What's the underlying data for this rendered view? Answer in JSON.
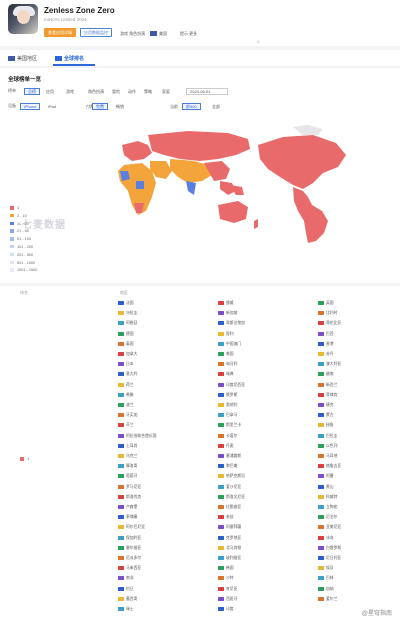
{
  "app": {
    "title": "Zenless Zone Zero",
    "subtitle": "miHoYo Limited 2024",
    "btn_primary": "查看应用详情",
    "btn_secondary": "应用数据监控",
    "meta": [
      "游戏 角色扮演",
      "美国",
      "提示 更多"
    ]
  },
  "tabs": [
    {
      "label": "美国地区",
      "flag": "#3c5aa8",
      "active": false
    },
    {
      "label": "全球排名",
      "flag": "#2b67d6",
      "active": true
    }
  ],
  "panel": {
    "title": "全球榜单一览",
    "row1_label": "榜单",
    "row1": [
      "总榜",
      "应用",
      "游戏",
      "角色扮演",
      "冒险",
      "动作",
      "策略",
      "家庭",
      "2024-06-01"
    ],
    "row2_label": "设备",
    "row2": [
      "iPhone",
      "iPad",
      "",
      "付费",
      "免费",
      "畅销",
      "",
      "",
      "当前",
      "前500",
      "全部"
    ],
    "legend": [
      "1",
      "2 - 10",
      "11 - 20",
      "21 - 50",
      "51 - 100",
      "101 - 200",
      "201 - 500",
      "501 - 1000",
      "1001 - 1500"
    ],
    "watermark": "七麦数据"
  },
  "colors": {
    "accent": "#2b67d6",
    "orange": "#f39a2e",
    "rank1": "#e86a6a",
    "rank2": "#f3a43a",
    "rank3": "#5a7fe0",
    "land": "#e5e5ea",
    "legend": [
      "#e86a6a",
      "#f3a43a",
      "#5a7fe0",
      "#8aa6ea",
      "#a9bdf0",
      "#c2d0f4",
      "#d4ddf6",
      "#e0e6f8",
      "#e8ecf8"
    ]
  },
  "table": {
    "col_rank": "排名",
    "col_regions": "地区",
    "rank_value": "1",
    "regions": [
      "法国",
      "挪威",
      "英国",
      "乌拉圭",
      "新加坡",
      "比利时",
      "阿根廷",
      "哥斯达黎加",
      "哥伦比亚",
      "德国",
      "智利",
      "巴西",
      "泰国",
      "中国澳门",
      "香港",
      "加拿大",
      "美国",
      "苏丹",
      "日本",
      "匈牙利",
      "澳大利亚",
      "意大利",
      "瑞典",
      "越南",
      "荷兰",
      "印度尼西亚",
      "新西兰",
      "希腊",
      "俄罗斯",
      "菲律宾",
      "波兰",
      "奥地利",
      "捷克",
      "牙买加",
      "巴拿马",
      "蒙古",
      "芬兰",
      "斯里兰卡",
      "秘鲁",
      "阿拉伯联合酋长国",
      "卡塔尔",
      "巴拉圭",
      "土耳其",
      "丹麦",
      "以色列",
      "乌克兰",
      "塞浦路斯",
      "马耳他",
      "摩洛哥",
      "黎巴嫩",
      "格鲁吉亚",
      "葡萄牙",
      "哈萨克斯坦",
      "阿曼",
      "罗马尼亚",
      "爱沙尼亚",
      "黑山",
      "斯洛伐克",
      "斯洛文尼亚",
      "科威特",
      "卢森堡",
      "拉脱维亚",
      "立陶宛",
      "柬埔寨",
      "老挝",
      "尼泊尔",
      "阿尔巴尼亚",
      "阿塞拜疆",
      "亚美尼亚",
      "保加利亚",
      "克罗地亚",
      "冰岛",
      "塞尔维亚",
      "北马其顿",
      "白俄罗斯",
      "厄瓜多尔",
      "玻利维亚",
      "尼日利亚",
      "马来西亚",
      "韩国",
      "埃及",
      "南非",
      "沙特",
      "巴林",
      "约旦",
      "肯尼亚",
      "加纳",
      "墨西哥",
      "西班牙",
      "爱尔兰",
      "瑞士",
      "印度",
      ""
    ]
  },
  "footer_watermark": "@星穹指南"
}
